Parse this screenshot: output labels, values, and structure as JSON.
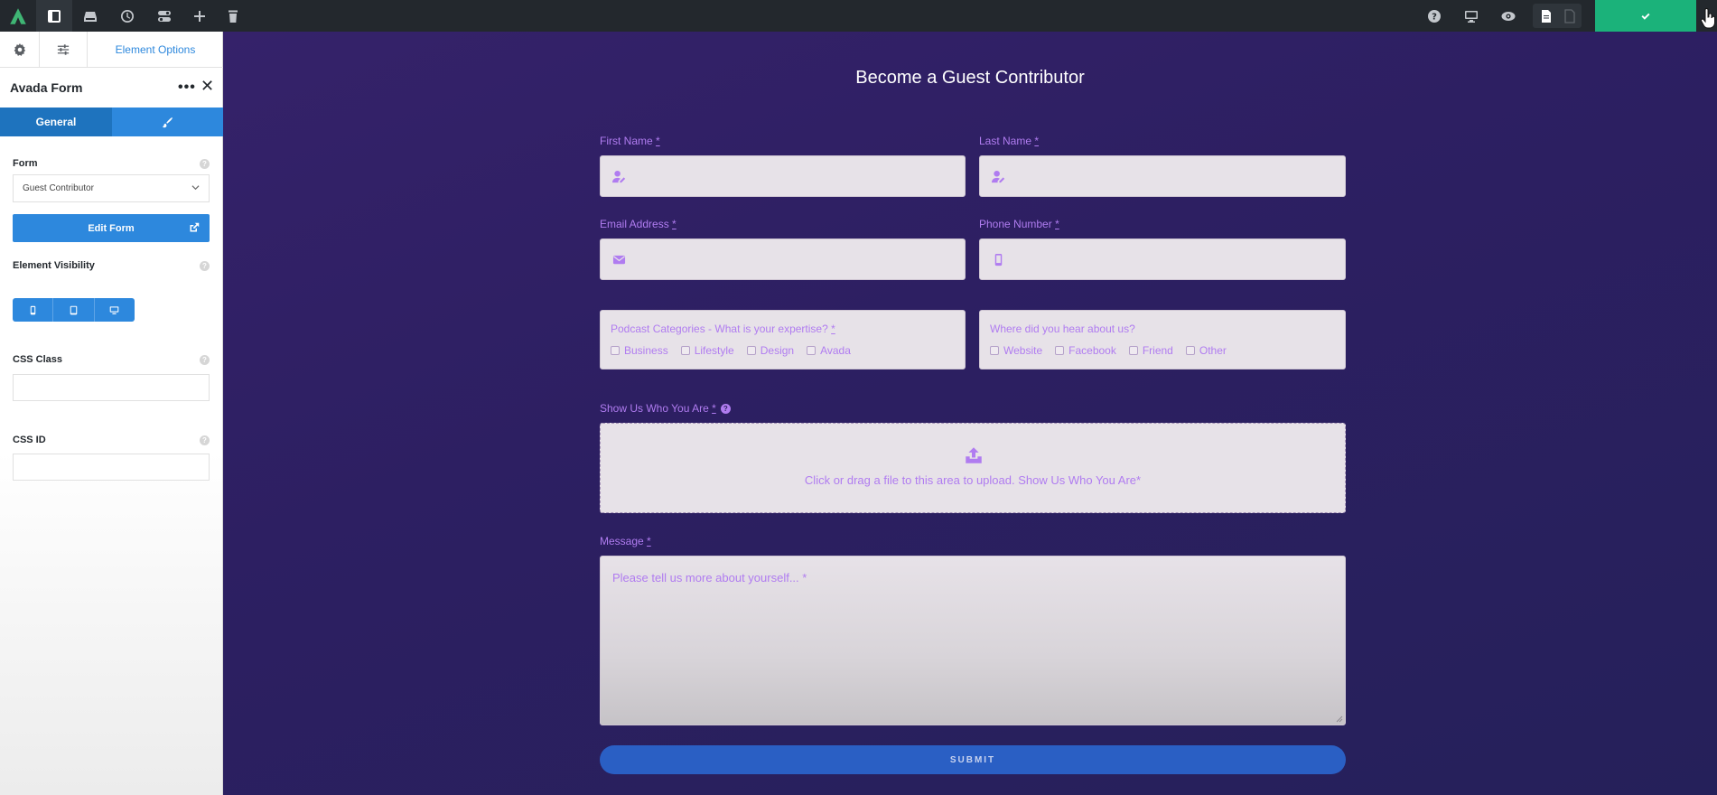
{
  "topbar": {
    "left_icons": [
      "avada-logo-icon",
      "sidebar-toggle-icon",
      "library-icon",
      "history-icon",
      "toggles-icon",
      "add-icon",
      "trash-icon"
    ],
    "right_icons": [
      "help-icon",
      "desktop-icon",
      "preview-icon",
      "page-icon",
      "page-outline-icon"
    ],
    "save_icon": "check-icon"
  },
  "sidebar": {
    "options_tab_label": "Element Options",
    "element_title": "Avada Form",
    "subtabs": {
      "general": "General",
      "design_icon": "brush-icon"
    },
    "form_field": {
      "label": "Form",
      "value": "Guest Contributor"
    },
    "edit_form_label": "Edit Form",
    "visibility_label": "Element Visibility",
    "visibility_icons": [
      "mobile-icon",
      "tablet-icon",
      "desktop-icon"
    ],
    "css_class_label": "CSS Class",
    "css_class_value": "",
    "css_id_label": "CSS ID",
    "css_id_value": "",
    "help_glyph": "?"
  },
  "form": {
    "title": "Become a Guest Contributor",
    "required_mark": "*",
    "first_name": {
      "label": "First Name",
      "icon": "user-edit-icon"
    },
    "last_name": {
      "label": "Last Name",
      "icon": "user-edit-icon"
    },
    "email": {
      "label": "Email Address",
      "icon": "envelope-icon"
    },
    "phone": {
      "label": "Phone Number",
      "icon": "mobile-icon"
    },
    "categories": {
      "label": "Podcast Categories - What is your expertise?",
      "options": [
        "Business",
        "Lifestyle",
        "Design",
        "Avada"
      ]
    },
    "source": {
      "label": "Where did you hear about us?",
      "options": [
        "Website",
        "Facebook",
        "Friend",
        "Other"
      ]
    },
    "upload": {
      "label": "Show Us Who You Are",
      "help_glyph": "?",
      "text": "Click or drag a file to this area to upload. Show Us Who You Are*"
    },
    "message": {
      "label": "Message",
      "placeholder": "Please tell us more about yourself... *"
    },
    "submit_label": "SUBMIT"
  },
  "colors": {
    "canvas": "#2d1f62",
    "accent_purple": "#b07cf0",
    "sidebar_blue": "#2d88dd",
    "save_green": "#1bb27a",
    "submit_blue": "#2a5fc4"
  }
}
